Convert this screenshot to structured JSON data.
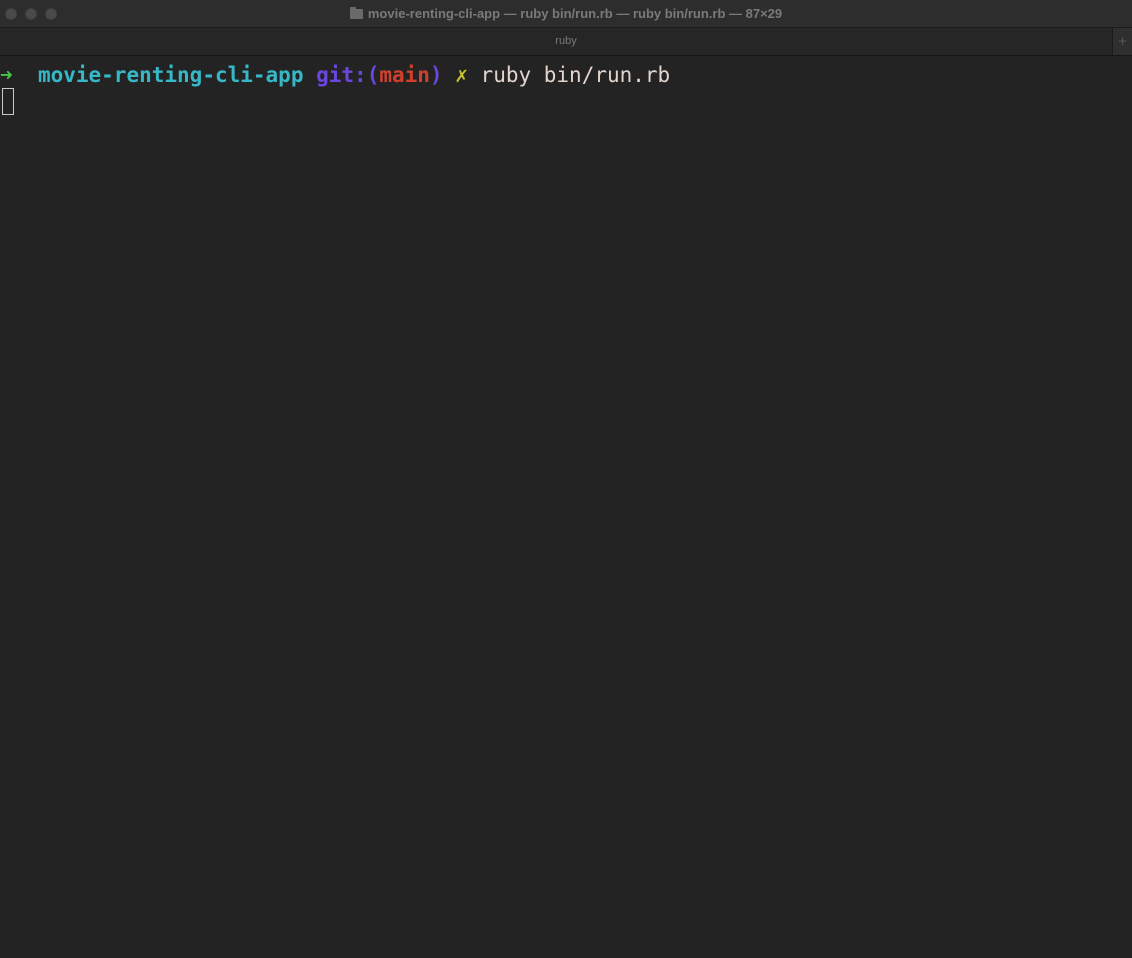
{
  "window": {
    "title": "movie-renting-cli-app — ruby bin/run.rb — ruby bin/run.rb — 87×29",
    "title_icon": "folder-icon",
    "tab_label": "ruby",
    "new_tab_glyph": "+"
  },
  "prompt": {
    "arrow": "➜",
    "directory": "movie-renting-cli-app",
    "git_prefix": "git:(",
    "branch": "main",
    "git_suffix": ")",
    "dirty_marker": "✗",
    "command": "ruby bin/run.rb"
  },
  "colors": {
    "background": "#232323",
    "arrow": "#46c646",
    "directory": "#36b8c6",
    "git": "#6b46e0",
    "branch": "#d2402c",
    "dirty": "#c9c22f",
    "command": "#e3d5cd"
  }
}
